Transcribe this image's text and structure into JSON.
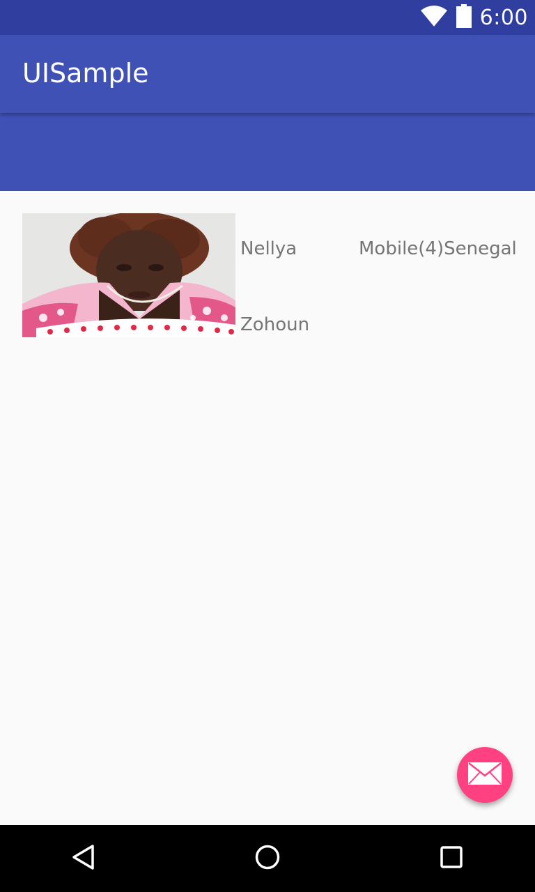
{
  "status_bar": {
    "time": "6:00",
    "icons": [
      "wifi-icon",
      "battery-icon"
    ]
  },
  "app_bar": {
    "title": "UISample"
  },
  "list": {
    "items": [
      {
        "photo": "person-photo",
        "first_name": "Nellya",
        "last_name": "Zohoun",
        "meta": "Mobile(4)Senegal"
      }
    ]
  },
  "fab": {
    "icon": "mail-icon"
  },
  "nav_bar": {
    "buttons": [
      "back-icon",
      "home-icon",
      "recents-icon"
    ]
  },
  "colors": {
    "status_bar": "#303f9f",
    "primary": "#3f51b5",
    "accent": "#ff4081",
    "background": "#fafafa",
    "text_secondary": "#757575",
    "nav_bar": "#000000"
  }
}
